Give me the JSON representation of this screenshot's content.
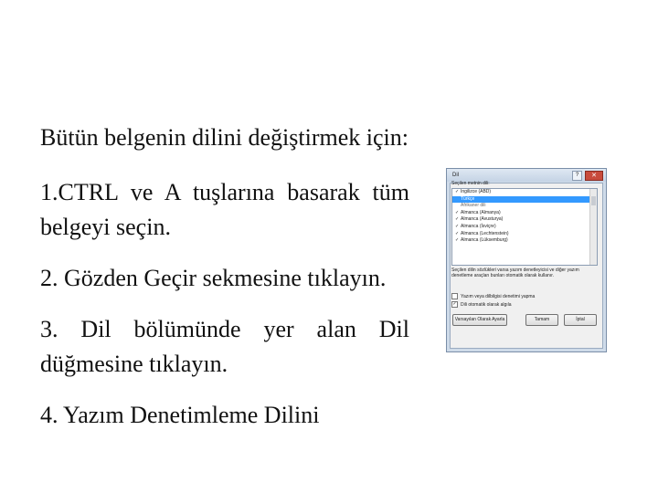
{
  "paragraphs": [
    "Bütün belgenin dilini değiştirmek için:",
    "1.CTRL ve A tuşlarına basarak tüm belgeyi seçin.",
    "2. Gözden Geçir sekmesine tıklayın.",
    "3. Dil bölümünde yer alan Dil düğmesine tıklayın.",
    "4. Yazım Denetimleme Dilini"
  ],
  "dialog": {
    "title": "Dil",
    "help_label": "?",
    "close_label": "✕",
    "list_label": "Seçilen metnin dili:",
    "languages": [
      {
        "label": "İngilizce (ABD)",
        "checked": true,
        "selected": false,
        "header": false
      },
      {
        "label": "Türkçe",
        "checked": false,
        "selected": true,
        "header": false
      },
      {
        "label": "Afrikaner dili",
        "checked": false,
        "selected": false,
        "header": true
      },
      {
        "label": "Almanca (Almanya)",
        "checked": true,
        "selected": false,
        "header": false
      },
      {
        "label": "Almanca (Avusturya)",
        "checked": true,
        "selected": false,
        "header": false
      },
      {
        "label": "Almanca (İsviçre)",
        "checked": true,
        "selected": false,
        "header": false
      },
      {
        "label": "Almanca (Lechtenstein)",
        "checked": true,
        "selected": false,
        "header": false
      },
      {
        "label": "Almanca (Lüksemburg)",
        "checked": true,
        "selected": false,
        "header": false
      }
    ],
    "note": "Seçilen dilin sözlükleri varsa yazım denetleyicisi ve diğer yazım denetleme araçları bunları otomatik olarak kullanır.",
    "checkbox_no_proof": "Yazım veya dilbilgisi denetimi yapma",
    "checkbox_autodetect": "Dili otomatik olarak algıla",
    "autodetect_checked": true,
    "button_default": "Varsayılan Olarak Ayarla",
    "button_ok": "Tamam",
    "button_cancel": "İptal"
  }
}
